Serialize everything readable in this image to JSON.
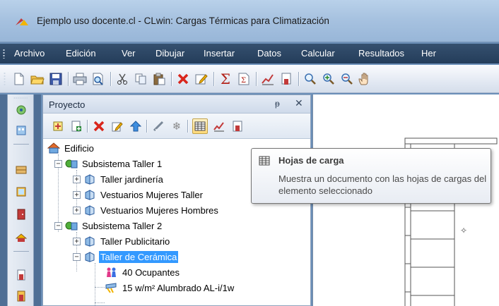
{
  "window": {
    "title": "Ejemplo uso docente.cl - CLwin: Cargas Térmicas para Climatización"
  },
  "menu": {
    "items": [
      "Archivo",
      "Edición",
      "Ver",
      "Dibujar",
      "Insertar",
      "Datos",
      "Calcular",
      "Resultados",
      "Her"
    ]
  },
  "panel": {
    "title": "Proyecto",
    "pin_glyph": "ᵽ",
    "close_glyph": "✕"
  },
  "tree": {
    "root": "Edificio",
    "subsystem1": {
      "label": "Subsistema Taller 1",
      "children": [
        "Taller jardinería",
        "Vestuarios Mujeres Taller",
        "Vestuarios Mujeres Hombres"
      ]
    },
    "subsystem2": {
      "label": "Subsistema Taller 2",
      "children": [
        "Taller Publicitario",
        "Taller de Cerámica"
      ],
      "selected_children": [
        "40 Ocupantes",
        "15 w/m² Alumbrado AL-i/1w"
      ]
    },
    "expander_plus": "+",
    "expander_minus": "−"
  },
  "tooltip": {
    "title": "Hojas de carga",
    "description": "Muestra un documento con las hojas de cargas del elemento seleccionado"
  },
  "colors": {
    "selection": "#3399ff",
    "titlebar": "#a7c2e0",
    "menubar": "#2c4664"
  }
}
